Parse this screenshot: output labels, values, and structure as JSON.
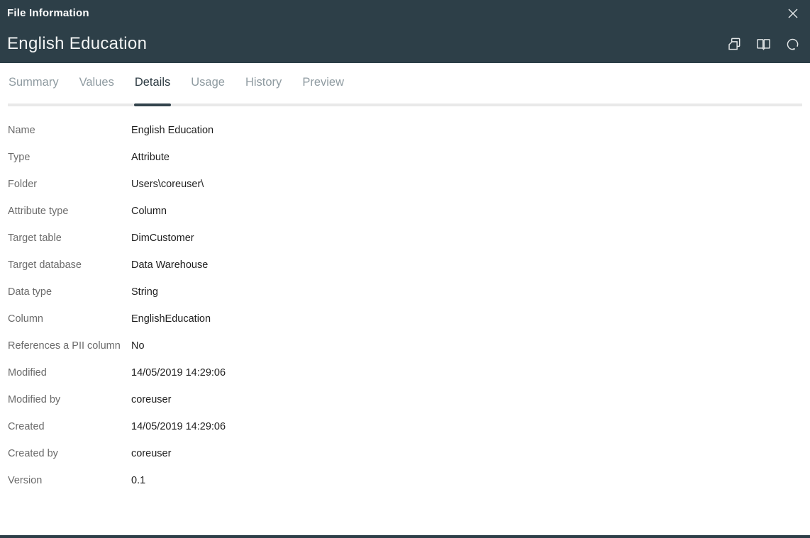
{
  "dialog": {
    "title": "File Information",
    "subtitle": "English Education"
  },
  "colors": {
    "header_bg": "#2d3f48",
    "active_tab_underline": "#33434c",
    "inactive_tab_text": "#8f9ba1"
  },
  "icons": {
    "close": "close-icon",
    "copy": "copy-icon",
    "book": "open-book-icon",
    "refresh": "refresh-icon"
  },
  "tabs": {
    "items": [
      {
        "label": "Summary",
        "active": false
      },
      {
        "label": "Values",
        "active": false
      },
      {
        "label": "Details",
        "active": true
      },
      {
        "label": "Usage",
        "active": false
      },
      {
        "label": "History",
        "active": false
      },
      {
        "label": "Preview",
        "active": false
      }
    ]
  },
  "details": {
    "rows": [
      {
        "label": "Name",
        "value": "English Education"
      },
      {
        "label": "Type",
        "value": "Attribute"
      },
      {
        "label": "Folder",
        "value": "Users\\coreuser\\"
      },
      {
        "label": "Attribute type",
        "value": "Column"
      },
      {
        "label": "Target table",
        "value": "DimCustomer"
      },
      {
        "label": "Target database",
        "value": "Data Warehouse"
      },
      {
        "label": "Data type",
        "value": "String"
      },
      {
        "label": "Column",
        "value": "EnglishEducation"
      },
      {
        "label": "References a PII column",
        "value": "No"
      },
      {
        "label": "Modified",
        "value": "14/05/2019 14:29:06"
      },
      {
        "label": "Modified by",
        "value": "coreuser"
      },
      {
        "label": "Created",
        "value": "14/05/2019 14:29:06"
      },
      {
        "label": "Created by",
        "value": "coreuser"
      },
      {
        "label": "Version",
        "value": "0.1"
      }
    ]
  }
}
